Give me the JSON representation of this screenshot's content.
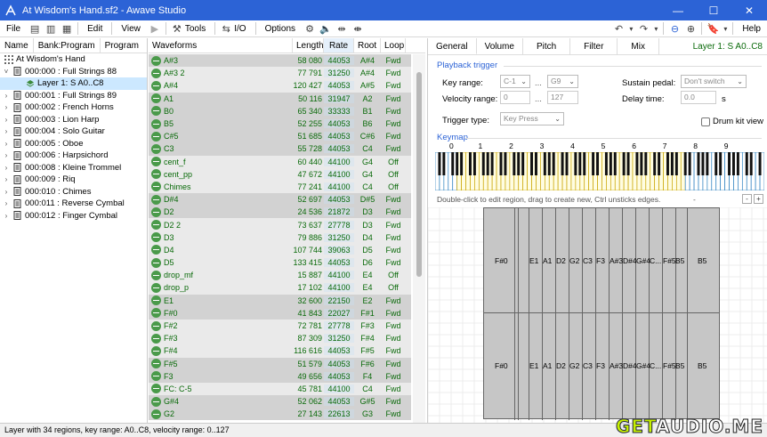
{
  "window": {
    "title": "At Wisdom's Hand.sf2 - Awave Studio"
  },
  "menu": {
    "file": "File",
    "edit": "Edit",
    "view": "View",
    "tools": "Tools",
    "io": "I/O",
    "options": "Options",
    "help": "Help"
  },
  "left": {
    "tabs": [
      "Name",
      "Bank:Program",
      "Program"
    ],
    "tree": [
      {
        "label": "At Wisdom's Hand",
        "level": 0,
        "icon": "grid-icon"
      },
      {
        "label": "000:000 : Full Strings 88",
        "level": 1,
        "icon": "instrument-icon",
        "chev": "˅"
      },
      {
        "label": "Layer 1: S A0..C8",
        "level": 2,
        "icon": "layer-icon",
        "selected": true
      },
      {
        "label": "000:001 : Full Strings 89",
        "level": 1,
        "icon": "instrument-icon",
        "chev": "›"
      },
      {
        "label": "000:002 : French Horns",
        "level": 1,
        "icon": "instrument-icon",
        "chev": "›"
      },
      {
        "label": "000:003 : Lion Harp",
        "level": 1,
        "icon": "instrument-icon",
        "chev": "›"
      },
      {
        "label": "000:004 : Solo Guitar",
        "level": 1,
        "icon": "instrument-icon",
        "chev": "›"
      },
      {
        "label": "000:005 : Oboe",
        "level": 1,
        "icon": "instrument-icon",
        "chev": "›"
      },
      {
        "label": "000:006 : Harpsichord",
        "level": 1,
        "icon": "instrument-icon",
        "chev": "›"
      },
      {
        "label": "000:008 : Kleine Trommel",
        "level": 1,
        "icon": "instrument-icon",
        "chev": "›"
      },
      {
        "label": "000:009 : Riq",
        "level": 1,
        "icon": "instrument-icon",
        "chev": "›"
      },
      {
        "label": "000:010 : Chimes",
        "level": 1,
        "icon": "instrument-icon",
        "chev": "›"
      },
      {
        "label": "000:011 : Reverse Cymbal",
        "level": 1,
        "icon": "instrument-icon",
        "chev": "›"
      },
      {
        "label": "000:012 : Finger Cymbal",
        "level": 1,
        "icon": "instrument-icon",
        "chev": "›"
      }
    ]
  },
  "waveforms": {
    "headers": {
      "name": "Waveforms",
      "length": "Length",
      "rate": "Rate",
      "root": "Root",
      "loop": "Loop"
    },
    "rows": [
      {
        "name": "A#3",
        "length": "58 080",
        "rate": "44053",
        "root": "A#4",
        "loop": "Fwd",
        "shade": "grey"
      },
      {
        "name": "A#3 2",
        "length": "77 791",
        "rate": "31250",
        "root": "A#4",
        "loop": "Fwd",
        "shade": "white"
      },
      {
        "name": "A#4",
        "length": "120 427",
        "rate": "44053",
        "root": "A#5",
        "loop": "Fwd",
        "shade": "white"
      },
      {
        "name": "A1",
        "length": "50 116",
        "rate": "31947",
        "root": "A2",
        "loop": "Fwd",
        "shade": "grey"
      },
      {
        "name": "B0",
        "length": "65 340",
        "rate": "33333",
        "root": "B1",
        "loop": "Fwd",
        "shade": "grey"
      },
      {
        "name": "B5",
        "length": "52 255",
        "rate": "44053",
        "root": "B6",
        "loop": "Fwd",
        "shade": "grey"
      },
      {
        "name": "C#5",
        "length": "51 685",
        "rate": "44053",
        "root": "C#6",
        "loop": "Fwd",
        "shade": "grey"
      },
      {
        "name": "C3",
        "length": "55 728",
        "rate": "44053",
        "root": "C4",
        "loop": "Fwd",
        "shade": "grey"
      },
      {
        "name": "cent_f",
        "length": "60 440",
        "rate": "44100",
        "root": "G4",
        "loop": "Off",
        "shade": "white"
      },
      {
        "name": "cent_pp",
        "length": "47 672",
        "rate": "44100",
        "root": "G4",
        "loop": "Off",
        "shade": "white"
      },
      {
        "name": "Chimes",
        "length": "77 241",
        "rate": "44100",
        "root": "C4",
        "loop": "Off",
        "shade": "white"
      },
      {
        "name": "D#4",
        "length": "52 697",
        "rate": "44053",
        "root": "D#5",
        "loop": "Fwd",
        "shade": "grey"
      },
      {
        "name": "D2",
        "length": "24 536",
        "rate": "21872",
        "root": "D3",
        "loop": "Fwd",
        "shade": "grey"
      },
      {
        "name": "D2 2",
        "length": "73 637",
        "rate": "27778",
        "root": "D3",
        "loop": "Fwd",
        "shade": "white"
      },
      {
        "name": "D3",
        "length": "79 886",
        "rate": "31250",
        "root": "D4",
        "loop": "Fwd",
        "shade": "white"
      },
      {
        "name": "D4",
        "length": "107 744",
        "rate": "39063",
        "root": "D5",
        "loop": "Fwd",
        "shade": "white"
      },
      {
        "name": "D5",
        "length": "133 415",
        "rate": "44053",
        "root": "D6",
        "loop": "Fwd",
        "shade": "white"
      },
      {
        "name": "drop_mf",
        "length": "15 887",
        "rate": "44100",
        "root": "E4",
        "loop": "Off",
        "shade": "white"
      },
      {
        "name": "drop_p",
        "length": "17 102",
        "rate": "44100",
        "root": "E4",
        "loop": "Off",
        "shade": "white"
      },
      {
        "name": "E1",
        "length": "32 600",
        "rate": "22150",
        "root": "E2",
        "loop": "Fwd",
        "shade": "grey"
      },
      {
        "name": "F#0",
        "length": "41 843",
        "rate": "22027",
        "root": "F#1",
        "loop": "Fwd",
        "shade": "grey"
      },
      {
        "name": "F#2",
        "length": "72 781",
        "rate": "27778",
        "root": "F#3",
        "loop": "Fwd",
        "shade": "white"
      },
      {
        "name": "F#3",
        "length": "87 309",
        "rate": "31250",
        "root": "F#4",
        "loop": "Fwd",
        "shade": "white"
      },
      {
        "name": "F#4",
        "length": "116 616",
        "rate": "44053",
        "root": "F#5",
        "loop": "Fwd",
        "shade": "white"
      },
      {
        "name": "F#5",
        "length": "51 579",
        "rate": "44053",
        "root": "F#6",
        "loop": "Fwd",
        "shade": "grey"
      },
      {
        "name": "F3",
        "length": "49 656",
        "rate": "44053",
        "root": "F4",
        "loop": "Fwd",
        "shade": "grey"
      },
      {
        "name": "FC: C-5",
        "length": "45 781",
        "rate": "44100",
        "root": "C4",
        "loop": "Fwd",
        "shade": "white"
      },
      {
        "name": "G#4",
        "length": "52 062",
        "rate": "44053",
        "root": "G#5",
        "loop": "Fwd",
        "shade": "grey"
      },
      {
        "name": "G2",
        "length": "27 143",
        "rate": "22613",
        "root": "G3",
        "loop": "Fwd",
        "shade": "grey"
      }
    ]
  },
  "right": {
    "tabs": [
      "General",
      "Volume",
      "Pitch",
      "Filter",
      "Mix"
    ],
    "layer_info": "Layer 1: S A0..C8",
    "playback": {
      "title": "Playback trigger",
      "key_range_label": "Key range:",
      "key_from": "C-1",
      "range_sep": "...",
      "key_to": "G9",
      "vel_label": "Velocity range:",
      "vel_from": "0",
      "vel_to": "127",
      "trigger_label": "Trigger type:",
      "trigger_value": "Key Press",
      "sustain_label": "Sustain pedal:",
      "sustain_value": "Don't switch",
      "delay_label": "Delay time:",
      "delay_value": "0.0",
      "delay_unit": "s",
      "drumkit_label": "Drum kit view"
    },
    "keymap": {
      "title": "Keymap",
      "octave_numbers": [
        "0",
        "1",
        "2",
        "3",
        "4",
        "5",
        "6",
        "7",
        "8",
        "9"
      ],
      "hint": "Double-click to edit region, drag to create new, Ctrl unsticks edges.",
      "dash": "-",
      "zoom_out": "-",
      "zoom_in": "+",
      "regions_top": [
        "F#0",
        "E1",
        "A1",
        "D2",
        "G2",
        "C3",
        "F3",
        "A#3",
        "D#4",
        "G#4",
        "C...",
        "F#5",
        "B5",
        "B5"
      ],
      "regions_bottom": [
        "F#0",
        "E1",
        "A1",
        "D2",
        "G2",
        "C3",
        "F3",
        "A#3",
        "D#4",
        "G#4",
        "C...",
        "F#5",
        "B5",
        "B5"
      ]
    }
  },
  "status": {
    "text": "Layer with 34 regions, key range: A0..C8, velocity range: 0..127"
  },
  "watermark": {
    "prefix": "GET",
    "text": "AUDIO.ME"
  }
}
